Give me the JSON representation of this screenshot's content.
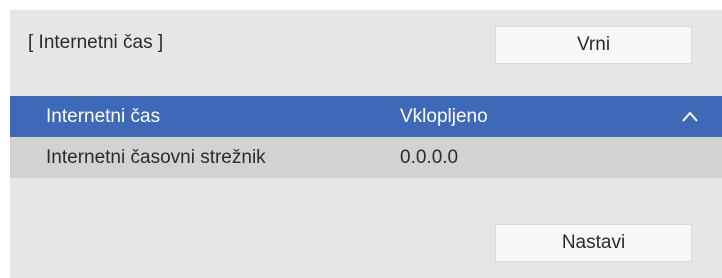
{
  "header": {
    "title": "[ Internetni čas ]",
    "back_label": "Vrni"
  },
  "settings": [
    {
      "label": "Internetni čas",
      "value": "Vklopljeno",
      "selected": true
    },
    {
      "label": "Internetni časovni strežnik",
      "value": "0.0.0.0",
      "selected": false
    }
  ],
  "footer": {
    "set_label": "Nastavi"
  },
  "icons": {
    "expand": "chevron-up-icon"
  },
  "colors": {
    "highlight": "#3e68b8",
    "panel": "#e6e6e6"
  }
}
